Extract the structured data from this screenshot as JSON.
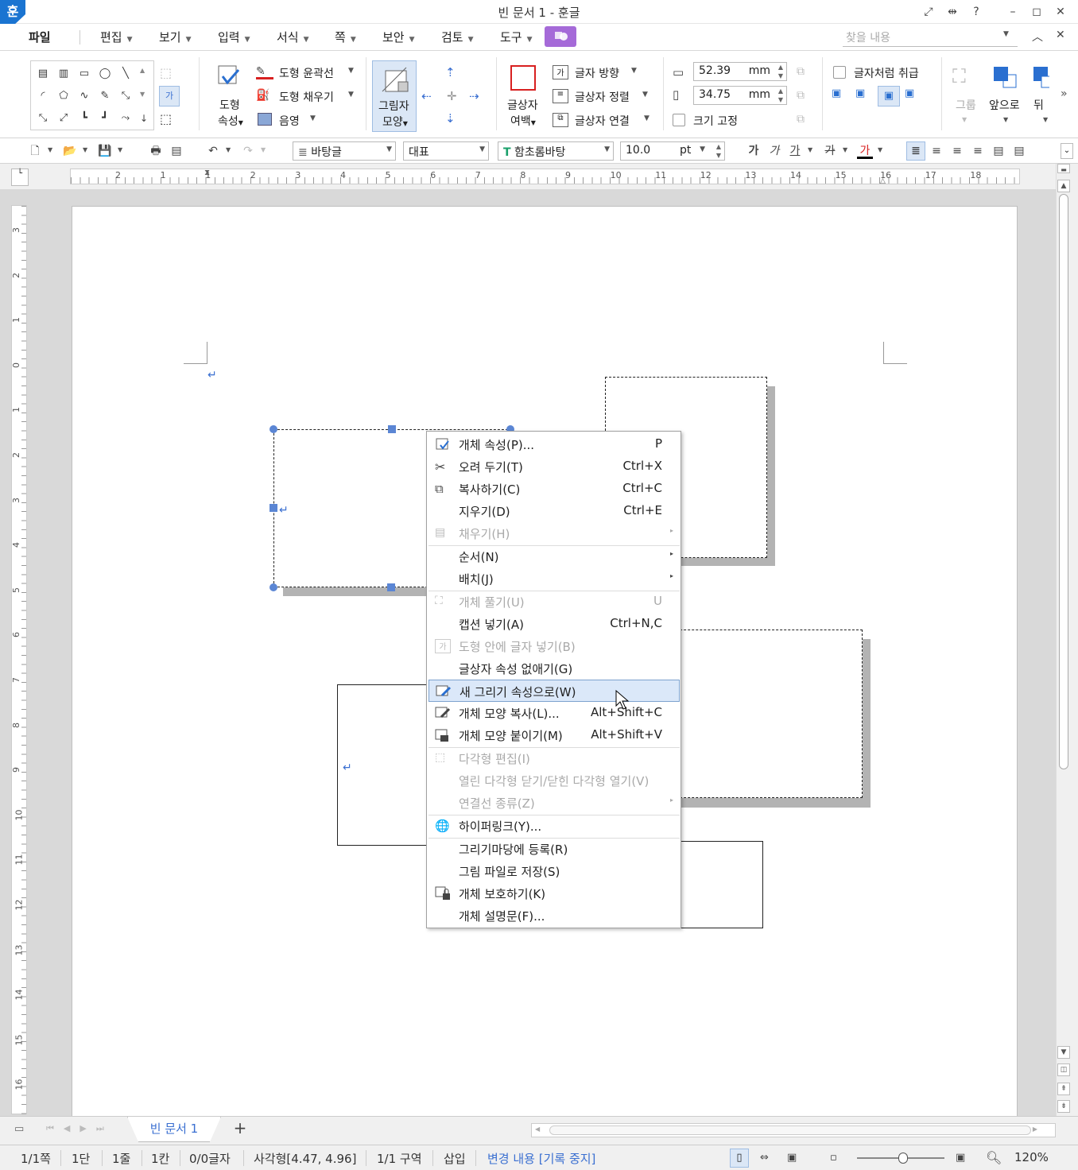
{
  "window": {
    "title": "빈 문서 1 - 훈글",
    "logo": "훈"
  },
  "menu": {
    "file": "파일",
    "items": [
      "편집",
      "보기",
      "입력",
      "서식",
      "쪽",
      "보안",
      "검토",
      "도구"
    ],
    "search_placeholder": "찾을 내용"
  },
  "ribbon": {
    "shape_props": [
      "도형",
      "속성"
    ],
    "outline": "도형 윤곽선",
    "fill": "도형 채우기",
    "shadow_small": "음영",
    "shadow_shape": [
      "그림자",
      "모양"
    ],
    "textbox_margin": [
      "글상자",
      "여백"
    ],
    "text_direction": "글자 방향",
    "textbox_align": "글상자 정렬",
    "textbox_link": "글상자 연결",
    "width_value": "52.39",
    "height_value": "34.75",
    "unit": "mm",
    "fixed_size": "크기 고정",
    "treat_as_char": "글자처럼 취급",
    "group": "그룹",
    "bring_front": "앞으로",
    "send_back": "뒤"
  },
  "toolbar2": {
    "style": "바탕글",
    "lang": "대표",
    "font": "함초롬바탕",
    "size": "10.0",
    "size_unit": "pt",
    "bold": "가",
    "italic": "가",
    "underline": "가",
    "strike": "가",
    "color": "가"
  },
  "ruler": {
    "h_numbers": [
      "2",
      "1",
      "1",
      "2",
      "3",
      "4",
      "5",
      "6",
      "7",
      "8",
      "9",
      "10",
      "11",
      "12",
      "13",
      "14",
      "15",
      "16",
      "17",
      "18"
    ],
    "v_numbers": [
      "3",
      "2",
      "1",
      "0",
      "1",
      "2",
      "3",
      "4",
      "5",
      "6",
      "7",
      "8",
      "9",
      "10",
      "11",
      "12",
      "13",
      "14",
      "15",
      "16"
    ]
  },
  "context_menu": {
    "items": [
      {
        "label": "개체 속성(P)...",
        "shortcut": "P",
        "enabled": true,
        "icon": "object-properties-icon"
      },
      {
        "label": "오려 두기(T)",
        "shortcut": "Ctrl+X",
        "enabled": true,
        "icon": "cut-icon"
      },
      {
        "label": "복사하기(C)",
        "shortcut": "Ctrl+C",
        "enabled": true,
        "icon": "copy-icon"
      },
      {
        "label": "지우기(D)",
        "shortcut": "Ctrl+E",
        "enabled": true,
        "icon": ""
      },
      {
        "label": "채우기(H)",
        "shortcut": "",
        "enabled": false,
        "icon": "fill-icon",
        "submenu": true
      },
      {
        "label": "순서(N)",
        "shortcut": "",
        "enabled": true,
        "icon": "",
        "submenu": true
      },
      {
        "label": "배치(J)",
        "shortcut": "",
        "enabled": true,
        "icon": "",
        "submenu": true
      },
      {
        "label": "개체 풀기(U)",
        "shortcut": "U",
        "enabled": false,
        "icon": "ungroup-icon"
      },
      {
        "label": "캡션 넣기(A)",
        "shortcut": "Ctrl+N,C",
        "enabled": true,
        "icon": ""
      },
      {
        "label": "도형 안에 글자 넣기(B)",
        "shortcut": "",
        "enabled": false,
        "icon": "text-in-shape-icon"
      },
      {
        "label": "글상자 속성 없애기(G)",
        "shortcut": "",
        "enabled": true,
        "icon": ""
      },
      {
        "label": "새 그리기 속성으로(W)",
        "shortcut": "",
        "enabled": true,
        "icon": "new-draw-props-icon",
        "highlighted": true
      },
      {
        "label": "개체 모양 복사(L)...",
        "shortcut": "Alt+Shift+C",
        "enabled": true,
        "icon": "copy-shape-icon"
      },
      {
        "label": "개체 모양 붙이기(M)",
        "shortcut": "Alt+Shift+V",
        "enabled": true,
        "icon": "paste-shape-icon"
      },
      {
        "label": "다각형 편집(I)",
        "shortcut": "",
        "enabled": false,
        "icon": "polygon-edit-icon"
      },
      {
        "label": "열린 다각형 닫기/닫힌 다각형 열기(V)",
        "shortcut": "",
        "enabled": false,
        "icon": ""
      },
      {
        "label": "연결선 종류(Z)",
        "shortcut": "",
        "enabled": false,
        "icon": "",
        "submenu": true
      },
      {
        "label": "하이퍼링크(Y)...",
        "shortcut": "",
        "enabled": true,
        "icon": "hyperlink-icon"
      },
      {
        "label": "그리기마당에 등록(R)",
        "shortcut": "",
        "enabled": true,
        "icon": ""
      },
      {
        "label": "그림 파일로 저장(S)",
        "shortcut": "",
        "enabled": true,
        "icon": ""
      },
      {
        "label": "개체 보호하기(K)",
        "shortcut": "",
        "enabled": true,
        "icon": "lock-icon"
      },
      {
        "label": "개체 설명문(F)...",
        "shortcut": "",
        "enabled": true,
        "icon": ""
      }
    ]
  },
  "tabs": {
    "doc_tab": "빈 문서 1",
    "add": "+"
  },
  "status": {
    "page": "1/1쪽",
    "column": "1단",
    "line": "1줄",
    "col": "1칸",
    "chars": "0/0글자",
    "object": "사각형[4.47, 4.96]",
    "section": "1/1 구역",
    "mode": "삽입",
    "track": "변경 내용 [기록 중지]",
    "zoom": "120%"
  },
  "colors": {
    "accent": "#3a6fd1",
    "handle": "#5b86d4",
    "highlight": "#dbe8f9",
    "purple_tool": "#a56ad8"
  }
}
